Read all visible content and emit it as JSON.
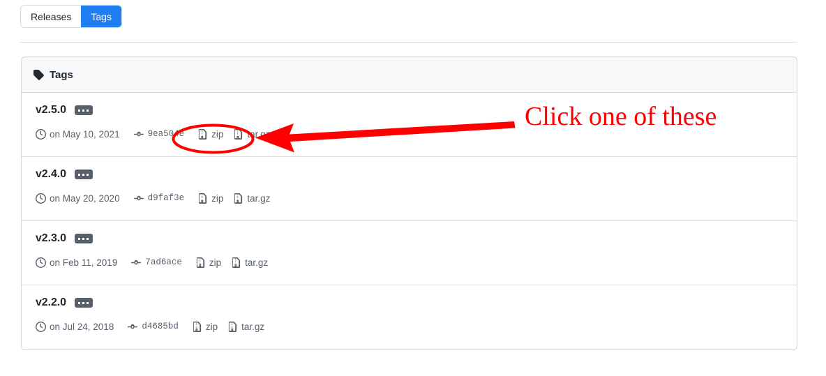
{
  "tabs": [
    {
      "label": "Releases",
      "selected": false
    },
    {
      "label": "Tags",
      "selected": true
    }
  ],
  "card": {
    "header_title": "Tags",
    "header_icon": "tag-icon"
  },
  "tags": [
    {
      "name": "v2.5.0",
      "badge": "ellipsis-badge",
      "date": "on May 10, 2021",
      "commit": "9ea504e",
      "downloads": [
        {
          "label": "zip",
          "icon": "file-zip-icon"
        },
        {
          "label": "tar.gz",
          "icon": "file-zip-icon"
        }
      ]
    },
    {
      "name": "v2.4.0",
      "badge": "ellipsis-badge",
      "date": "on May 20, 2020",
      "commit": "d9faf3e",
      "downloads": [
        {
          "label": "zip",
          "icon": "file-zip-icon"
        },
        {
          "label": "tar.gz",
          "icon": "file-zip-icon"
        }
      ]
    },
    {
      "name": "v2.3.0",
      "badge": "ellipsis-badge",
      "date": "on Feb 11, 2019",
      "commit": "7ad6ace",
      "downloads": [
        {
          "label": "zip",
          "icon": "file-zip-icon"
        },
        {
          "label": "tar.gz",
          "icon": "file-zip-icon"
        }
      ]
    },
    {
      "name": "v2.2.0",
      "badge": "ellipsis-badge",
      "date": "on Jul 24, 2018",
      "commit": "d4685bd",
      "downloads": [
        {
          "label": "zip",
          "icon": "file-zip-icon"
        },
        {
          "label": "tar.gz",
          "icon": "file-zip-icon"
        }
      ]
    }
  ],
  "annotation": {
    "text": "Click one of these",
    "color": "#fe0000",
    "ellipse_target": "download-links-row-1",
    "arrow": "left-pointing-arrow"
  },
  "colors": {
    "accent_blue": "#1f7ef0",
    "border": "#d0d7de",
    "header_bg": "#f6f8fa",
    "text_primary": "#24292f",
    "text_muted": "#57606a",
    "annotation_red": "#fe0000",
    "badge_bg": "#57606a"
  }
}
